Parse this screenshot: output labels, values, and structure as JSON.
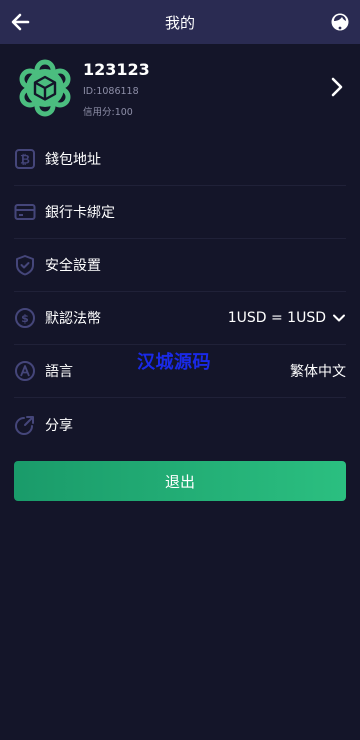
{
  "header": {
    "title": "我的"
  },
  "profile": {
    "name": "123123",
    "id_text": "ID:1086118",
    "credit_text": "信用分:100"
  },
  "menu": [
    {
      "key": "wallet",
      "label": "錢包地址",
      "icon": "bitcoin-wallet-icon"
    },
    {
      "key": "bank",
      "label": "銀行卡綁定",
      "icon": "credit-card-icon"
    },
    {
      "key": "security",
      "label": "安全設置",
      "icon": "shield-check-icon"
    },
    {
      "key": "currency",
      "label": "默認法幣",
      "icon": "dollar-circle-icon",
      "value": "1USD = 1USD"
    },
    {
      "key": "language",
      "label": "語言",
      "icon": "language-a-icon",
      "value": "繁体中文"
    },
    {
      "key": "share",
      "label": "分享",
      "icon": "share-arrow-icon"
    }
  ],
  "watermark": "汉城源码",
  "logout_label": "退出",
  "colors": {
    "background": "#141529",
    "header": "#2a2b52",
    "accent_green": "#22b074",
    "icon_stroke": "#45467a",
    "muted_text": "#8e8fa8"
  }
}
